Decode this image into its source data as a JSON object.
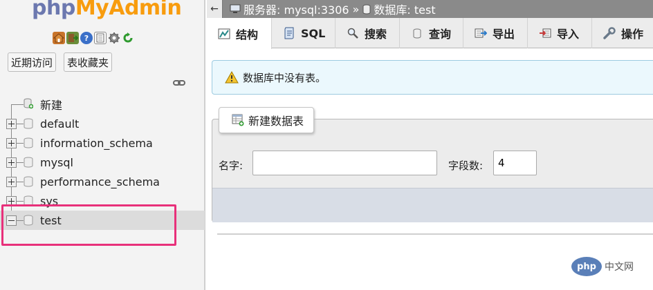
{
  "nav": {
    "logo_php": "php",
    "logo_myadmin": "MyAdmin",
    "icons": [
      "home-icon",
      "exit-icon",
      "help-icon",
      "docs-icon",
      "settings-icon",
      "reload-icon"
    ],
    "btn_recent": "近期访问",
    "btn_favorites": "表收藏夹",
    "tree": [
      {
        "label": "新建",
        "kind": "new"
      },
      {
        "label": "default",
        "kind": "db"
      },
      {
        "label": "information_schema",
        "kind": "db"
      },
      {
        "label": "mysql",
        "kind": "db"
      },
      {
        "label": "performance_schema",
        "kind": "db"
      },
      {
        "label": "sys",
        "kind": "db"
      },
      {
        "label": "test",
        "kind": "db",
        "selected": true
      }
    ]
  },
  "topbar": {
    "back": "←",
    "server": "服务器: mysql:3306",
    "sep": "»",
    "database": "数据库: test"
  },
  "tabs": [
    {
      "label": "结构",
      "icon": "structure-icon",
      "active": true
    },
    {
      "label": "SQL",
      "icon": "sql-icon"
    },
    {
      "label": "搜索",
      "icon": "search-icon"
    },
    {
      "label": "查询",
      "icon": "query-icon"
    },
    {
      "label": "导出",
      "icon": "export-icon"
    },
    {
      "label": "导入",
      "icon": "import-icon"
    },
    {
      "label": "操作",
      "icon": "operations-icon"
    }
  ],
  "notice": "数据库中没有表。",
  "create_table": {
    "title": "新建数据表",
    "name_label": "名字:",
    "name_value": "",
    "fields_label": "字段数:",
    "fields_value": "4"
  },
  "watermark": {
    "logo": "php",
    "text": "中文网"
  },
  "colors": {
    "logo_php": "#6c78af",
    "logo_myadmin": "#f89c0e",
    "highlight": "#e8307a",
    "topbar": "#8a8a8a"
  }
}
